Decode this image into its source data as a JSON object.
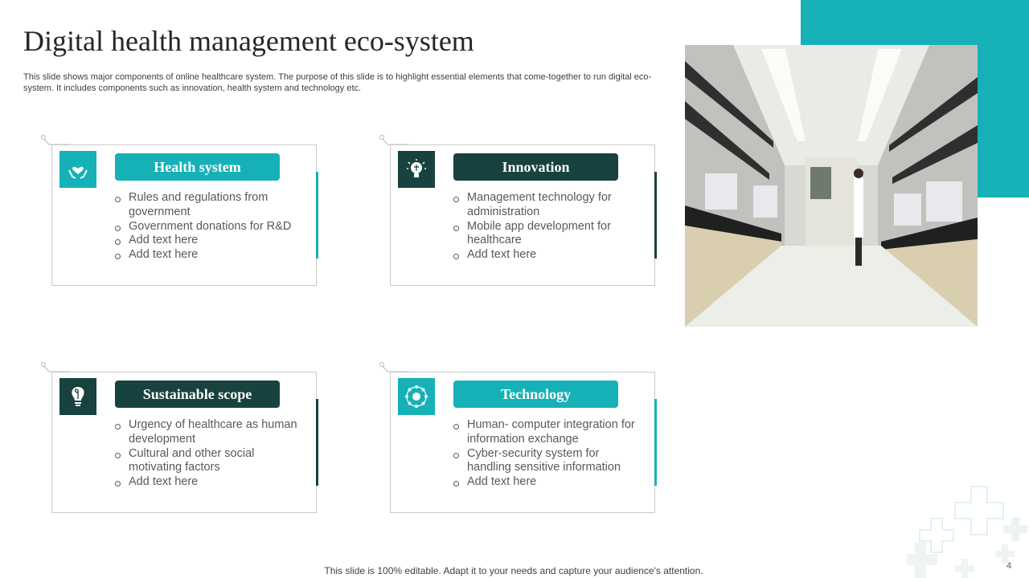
{
  "slide": {
    "title": "Digital health management eco-system",
    "description": "This slide shows major components of online healthcare system. The purpose of this slide is to highlight essential elements that come-together to run digital eco-system. It includes components such as innovation, health system and technology etc.",
    "footer": "This slide is 100% editable. Adapt it to your needs and capture your audience's attention.",
    "page_number": "4"
  },
  "colors": {
    "teal": "#16b1b7",
    "dark_teal": "#17423f",
    "text": "#595959",
    "border": "#c9c9c9"
  },
  "cards": [
    {
      "label": "Health system",
      "icon": "heart-hands-icon",
      "color": "#16b1b7",
      "items": [
        "Rules and regulations from government",
        "Government donations for R&D",
        "Add text here",
        "Add text here"
      ]
    },
    {
      "label": "Innovation",
      "icon": "lightbulb-brain-icon",
      "color": "#17423f",
      "items": [
        "Management technology for administration",
        "Mobile app development for healthcare",
        "Add text here"
      ]
    },
    {
      "label": "Sustainable scope",
      "icon": "lightbulb-leaf-icon",
      "color": "#17423f",
      "items": [
        "Urgency of healthcare as human development",
        "Cultural and other social motivating factors",
        "Add text here"
      ]
    },
    {
      "label": "Technology",
      "icon": "network-icon",
      "color": "#16b1b7",
      "items": [
        "Human- computer integration for information exchange",
        "Cyber-security system for handling sensitive information",
        "Add text here"
      ]
    }
  ]
}
